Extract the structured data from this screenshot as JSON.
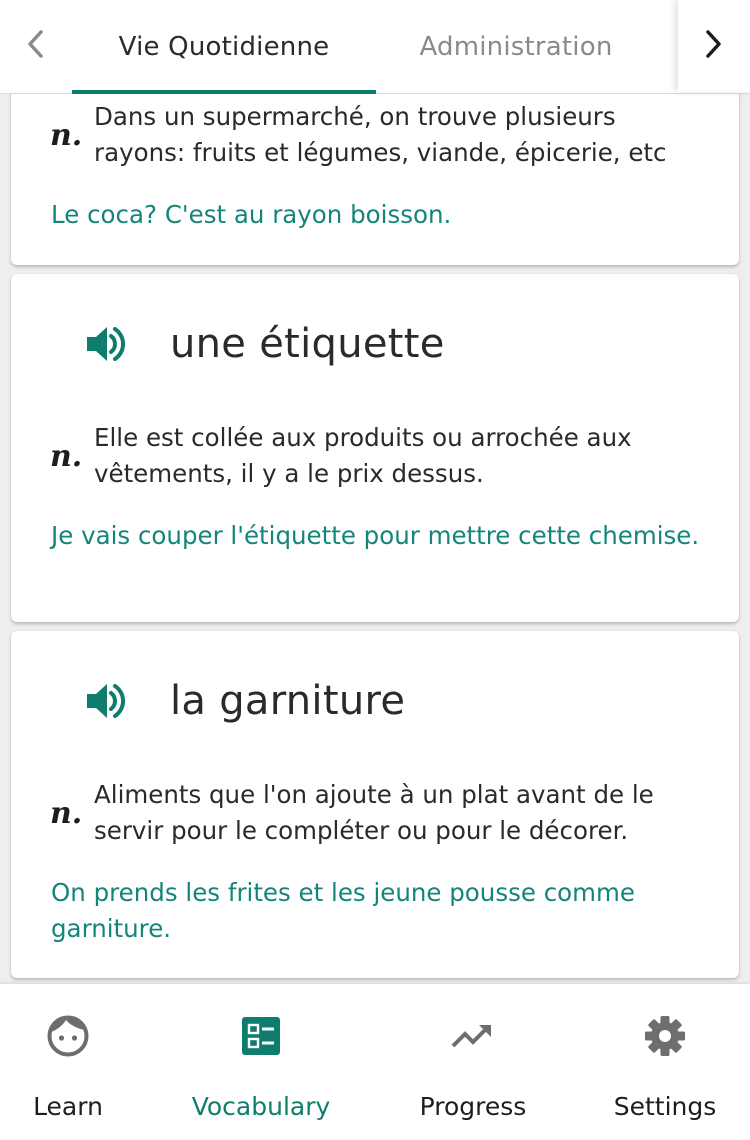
{
  "tabs": {
    "prev_icon": "chevron-left-icon",
    "next_icon": "chevron-right-icon",
    "items": [
      {
        "label": "Vie Quotidienne",
        "active": true
      },
      {
        "label": "Administration",
        "active": false
      }
    ]
  },
  "cards": [
    {
      "part_of_speech": "n.",
      "definition": "Dans un supermarché, on trouve plusieurs rayons: fruits et légumes, viande, épicerie, etc",
      "example": "Le coca? C'est au rayon boisson."
    },
    {
      "word": "une étiquette",
      "audio_icon": "speaker-icon",
      "part_of_speech": "n.",
      "definition": "Elle est collée aux produits ou arrochée aux vêtements, il y a le prix dessus.",
      "example": "Je vais couper l'étiquette pour mettre cette chemise."
    },
    {
      "word": "la garniture",
      "audio_icon": "speaker-icon",
      "part_of_speech": "n.",
      "definition": "Aliments que l'on ajoute à un plat avant de le servir pour le compléter ou pour le décorer.",
      "example": "On prends les frites et les jeune pousse comme garniture."
    }
  ],
  "bottom_nav": [
    {
      "label": "Learn",
      "icon": "face-icon",
      "active": false
    },
    {
      "label": "Vocabulary",
      "icon": "vocabulary-list-icon",
      "active": true
    },
    {
      "label": "Progress",
      "icon": "trending-up-icon",
      "active": false
    },
    {
      "label": "Settings",
      "icon": "gear-icon",
      "active": false
    }
  ],
  "colors": {
    "accent": "#0e7d6e",
    "example_text": "#14857a",
    "inactive_icon": "#6e6e6e"
  }
}
